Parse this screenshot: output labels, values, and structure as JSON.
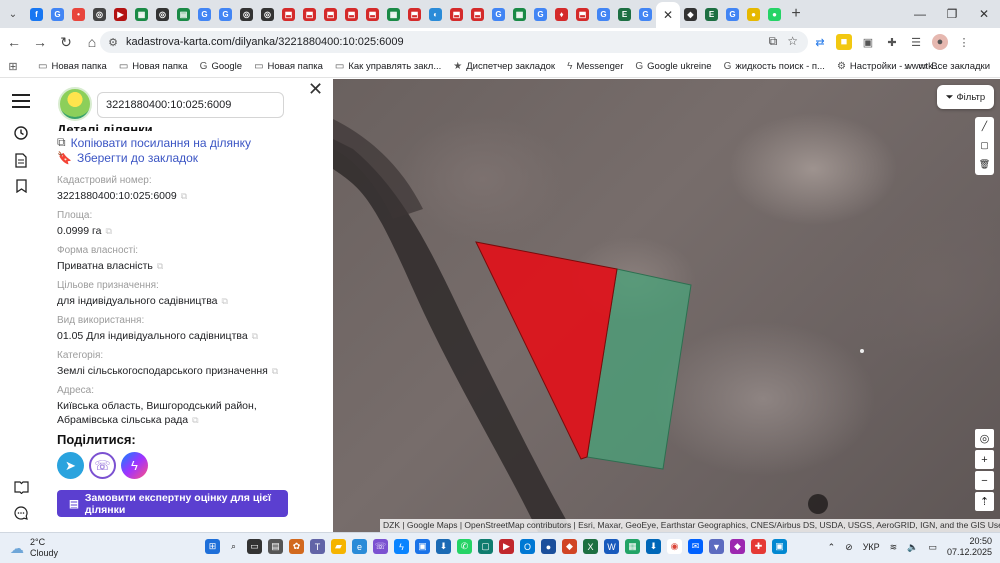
{
  "tabs": [
    {
      "icon": "facebook-icon",
      "color": "#1877f2",
      "glyph": "f"
    },
    {
      "icon": "google-icon",
      "color": "#4285f4",
      "glyph": "G"
    },
    {
      "icon": "pin-icon",
      "color": "#e8453c",
      "glyph": "•"
    },
    {
      "icon": "target-icon",
      "color": "#444",
      "glyph": "◎"
    },
    {
      "icon": "acrobat-icon",
      "color": "#b31212",
      "glyph": "▶"
    },
    {
      "icon": "sheet-icon",
      "color": "#1a8a46",
      "glyph": "▦"
    },
    {
      "icon": "target-icon",
      "color": "#333",
      "glyph": "◎"
    },
    {
      "icon": "book-icon",
      "color": "#1a8a46",
      "glyph": "▤"
    },
    {
      "icon": "google-icon",
      "color": "#4285f4",
      "glyph": "G"
    },
    {
      "icon": "google-icon",
      "color": "#4285f4",
      "glyph": "G"
    },
    {
      "icon": "target-icon",
      "color": "#333",
      "glyph": "◎"
    },
    {
      "icon": "target-icon",
      "color": "#333",
      "glyph": "◎"
    },
    {
      "icon": "pdf-icon",
      "color": "#d42a2a",
      "glyph": "⬒"
    },
    {
      "icon": "pdf-icon",
      "color": "#d42a2a",
      "glyph": "⬒"
    },
    {
      "icon": "pdf-icon",
      "color": "#d42a2a",
      "glyph": "⬒"
    },
    {
      "icon": "pdf-icon",
      "color": "#d42a2a",
      "glyph": "⬒"
    },
    {
      "icon": "pdf-icon",
      "color": "#d42a2a",
      "glyph": "⬒"
    },
    {
      "icon": "sheet-icon",
      "color": "#1a8a46",
      "glyph": "▦"
    },
    {
      "icon": "pdf-icon",
      "color": "#d42a2a",
      "glyph": "⬒"
    },
    {
      "icon": "edge-icon",
      "color": "#2a8bd8",
      "glyph": "◐"
    },
    {
      "icon": "pdf-icon",
      "color": "#d42a2a",
      "glyph": "⬒"
    },
    {
      "icon": "pdf-icon",
      "color": "#d42a2a",
      "glyph": "⬒"
    },
    {
      "icon": "google-icon",
      "color": "#4285f4",
      "glyph": "G"
    },
    {
      "icon": "sheet-icon",
      "color": "#1a8a46",
      "glyph": "▦"
    },
    {
      "icon": "google-icon",
      "color": "#4285f4",
      "glyph": "G"
    },
    {
      "icon": "heart-icon",
      "color": "#d42a2a",
      "glyph": "♦"
    },
    {
      "icon": "pdf-icon",
      "color": "#d42a2a",
      "glyph": "⬒"
    },
    {
      "icon": "google-icon",
      "color": "#4285f4",
      "glyph": "G"
    },
    {
      "icon": "excel-icon",
      "color": "#1d6f42",
      "glyph": "E"
    },
    {
      "icon": "google-icon",
      "color": "#4285f4",
      "glyph": "G"
    }
  ],
  "tabs_right": [
    {
      "icon": "bat-icon",
      "color": "#333",
      "glyph": "◆"
    },
    {
      "icon": "excel-icon",
      "color": "#1d6f42",
      "glyph": "E"
    },
    {
      "icon": "google-icon",
      "color": "#4285f4",
      "glyph": "G"
    },
    {
      "icon": "bulb-icon",
      "color": "#e6b800",
      "glyph": "●"
    },
    {
      "icon": "whatsapp-icon",
      "color": "#25d366",
      "glyph": "●"
    }
  ],
  "address": {
    "url": "kadastrova-karta.com/dilyanka/3221880400:10:025:6009"
  },
  "bookmarks": [
    {
      "icon": "folder-icon",
      "label": "Новая папка"
    },
    {
      "icon": "folder-icon",
      "label": "Новая папка"
    },
    {
      "icon": "google-icon",
      "label": "Google"
    },
    {
      "icon": "folder-icon",
      "label": "Новая папка"
    },
    {
      "icon": "folder-icon",
      "label": "Как управлять закл..."
    },
    {
      "icon": "star-icon",
      "label": "Диспетчер закладок"
    },
    {
      "icon": "messenger-icon",
      "label": "Messenger"
    },
    {
      "icon": "google-icon",
      "label": "Google ukreine"
    },
    {
      "icon": "google-icon",
      "label": "жидкость поиск - п..."
    },
    {
      "icon": "settings-icon",
      "label": "Настройки - wwwtk..."
    }
  ],
  "bookmarks_all": "Все закладки",
  "panel": {
    "search_value": "3221880400:10:025:6009",
    "details_title": "Деталі ділянки",
    "copy_link": "Копіювати посилання на ділянку",
    "save_bookmark": "Зберегти до закладок",
    "fields": [
      {
        "label": "Кадастровий номер:",
        "value": "3221880400:10:025:6009"
      },
      {
        "label": "Площа:",
        "value": "0.0999 га"
      },
      {
        "label": "Форма власності:",
        "value": "Приватна власність"
      },
      {
        "label": "Цільове призначення:",
        "value": "для індивідуального садівництва"
      },
      {
        "label": "Вид використання:",
        "value": "01.05 Для індивідуального садівництва"
      },
      {
        "label": "Категорія:",
        "value": "Землі сільськогосподарського призначення"
      },
      {
        "label": "Адреса:",
        "value": "Київська область, Вишгородський район, Абрамівська сільська рада"
      }
    ],
    "share_title": "Поділитися:",
    "order_button": "Замовити експертну оцінку для цієї ділянки"
  },
  "map": {
    "filter_label": "Фільтр",
    "attribution": "DZK | Google Maps | OpenStreetMap contributors | Esri, Maxar, GeoEye, Earthstar Geographics, CNES/Airbus DS, USDA, USGS, AeroGRID, IGN, and the GIS User Community",
    "parcel_selected_color": "#e0121b",
    "parcel_neighbor_color": "#4aa37a"
  },
  "taskbar": {
    "temp": "2°C",
    "weather": "Cloudy",
    "lang": "УКР",
    "time": "20:50",
    "date": "07.12.2025"
  }
}
